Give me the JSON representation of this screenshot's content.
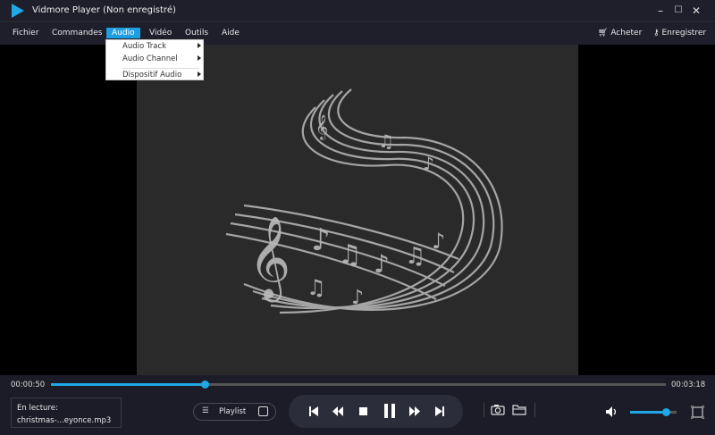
{
  "window": {
    "title": "Vidmore Player (Non enregistré)",
    "minimize": "–",
    "maximize": "☐",
    "close": "✕"
  },
  "menubar": {
    "items": [
      "Fichier",
      "Commandes",
      "Audio",
      "Vidéo",
      "Outils",
      "Aide"
    ],
    "active": "Audio",
    "buy": "Acheter",
    "register": "Enregistrer"
  },
  "audio_menu": {
    "items": [
      "Audio Track",
      "Audio Channel",
      "Dispositif Audio"
    ]
  },
  "playback": {
    "current_time": "00:00:50",
    "total_time": "00:03:18",
    "progress_percent": 25,
    "volume_percent": 77
  },
  "now_playing": {
    "label": "En lecture:",
    "file": "christmas-...eyonce.mp3"
  },
  "controls": {
    "playlist_label": "Playlist"
  },
  "colors": {
    "accent": "#1fa7e6",
    "background": "#1b1c27"
  }
}
